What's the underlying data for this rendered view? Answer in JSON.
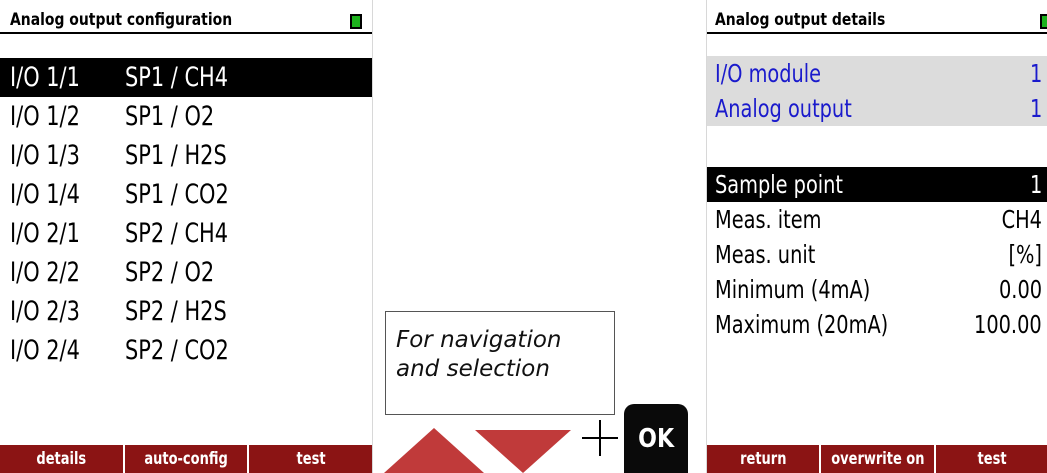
{
  "left_screen": {
    "title": "Analog output configuration",
    "rows": [
      {
        "io": "I/O 1/1",
        "assignment": "SP1 / CH4"
      },
      {
        "io": "I/O 1/2",
        "assignment": "SP1 / O2"
      },
      {
        "io": "I/O 1/3",
        "assignment": "SP1 / H2S"
      },
      {
        "io": "I/O 1/4",
        "assignment": "SP1 / CO2"
      },
      {
        "io": "I/O 2/1",
        "assignment": "SP2 / CH4"
      },
      {
        "io": "I/O 2/2",
        "assignment": "SP2 / O2"
      },
      {
        "io": "I/O 2/3",
        "assignment": "SP2 / H2S"
      },
      {
        "io": "I/O 2/4",
        "assignment": "SP2 / CO2"
      }
    ],
    "soft_keys": [
      "details",
      "auto-config",
      "test"
    ]
  },
  "right_screen": {
    "title": "Analog output details",
    "io_module_label": "I/O module",
    "io_module_value": "1",
    "analog_output_label": "Analog output",
    "analog_output_value": "1",
    "sample_point_label": "Sample point",
    "sample_point_value": "1",
    "meas_item_label": "Meas. item",
    "meas_item_value": "CH4",
    "meas_unit_label": "Meas. unit",
    "meas_unit_value": "[%]",
    "minimum_label": "Minimum (4mA)",
    "minimum_value": "0.00",
    "maximum_label": "Maximum (20mA)",
    "maximum_value": "100.00",
    "soft_keys": [
      "return",
      "overwrite on",
      "test"
    ]
  },
  "annotation": {
    "line1": "For navigation",
    "line2": "and selection"
  },
  "keys": {
    "ok_label": "OK",
    "up_icon": "arrow-up-icon",
    "down_icon": "arrow-down-icon",
    "plus_icon": "plus-icon"
  },
  "colors": {
    "softkey_bg": "#8b1414",
    "status_green": "#1db31d",
    "info_text": "#1a1acc",
    "info_bg": "#dcdcdc",
    "arrow_red": "#c03a3a"
  }
}
